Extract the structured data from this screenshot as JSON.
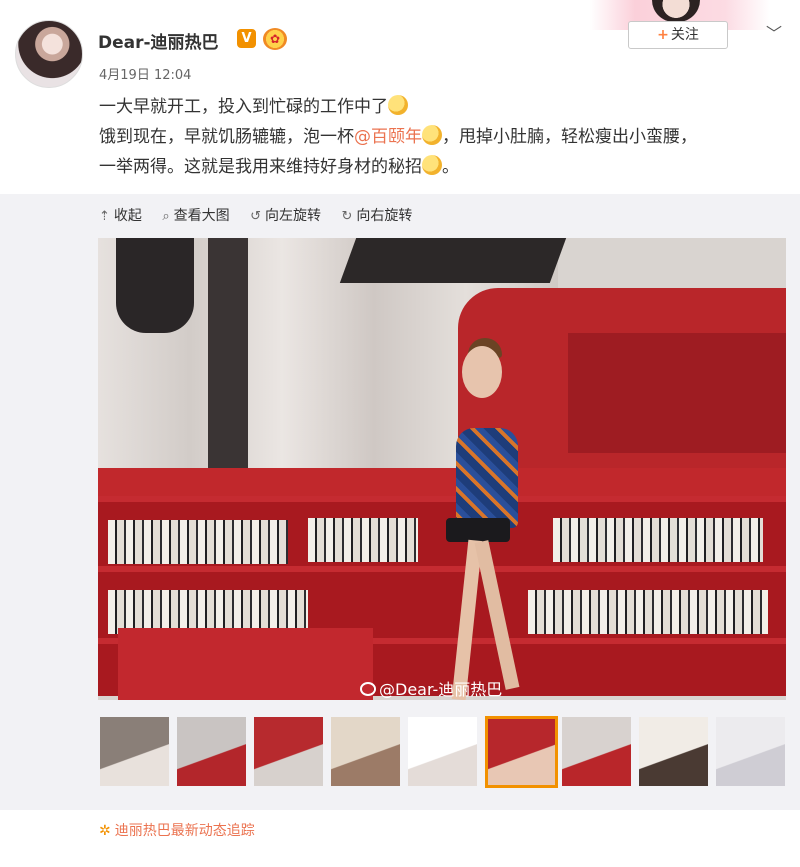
{
  "post": {
    "username": "Dear-迪丽热巴",
    "verified_badge": "V",
    "time": "4月19日 12:04",
    "follow_label": "关注",
    "follow_plus": "+",
    "more_icon": "chevron-down-icon",
    "content": {
      "line1": "一大早就开工，投入到忙碌的工作中了",
      "line2_prefix": "饿到现在，早就饥肠辘辘，泡一杯",
      "mention": "@百颐年",
      "line2_suffix": "，甩掉小肚腩，轻松瘦出小蛮腰，",
      "line3": "一举两得。这就是我用来维持好身材的秘招",
      "line3_end": "。"
    }
  },
  "media_tools": {
    "collapse": "收起",
    "view_large": "查看大图",
    "rotate_left": "向左旋转",
    "rotate_right": "向右旋转"
  },
  "photo": {
    "watermark": "@Dear-迪丽热巴"
  },
  "thumbnails": [
    {
      "color_a": "#8a7f78",
      "color_b": "#e8e1dc"
    },
    {
      "color_a": "#c9c4c2",
      "color_b": "#b3262b"
    },
    {
      "color_a": "#b72a2e",
      "color_b": "#d7d1cd"
    },
    {
      "color_a": "#e3d7c8",
      "color_b": "#9c7b67"
    },
    {
      "color_a": "#ffffff",
      "color_b": "#e4dcd8"
    },
    {
      "color_a": "#b7272c",
      "color_b": "#e8c7b4"
    },
    {
      "color_a": "#d8d2cf",
      "color_b": "#b9262a"
    },
    {
      "color_a": "#f1ece6",
      "color_b": "#4a3a33"
    },
    {
      "color_a": "#ecebee",
      "color_b": "#cfcdd4"
    }
  ],
  "active_thumbnail": 5,
  "tracker": {
    "label": "迪丽热巴最新动态追踪"
  },
  "colors": {
    "accent_orange": "#f29100",
    "link": "#eb7350"
  }
}
